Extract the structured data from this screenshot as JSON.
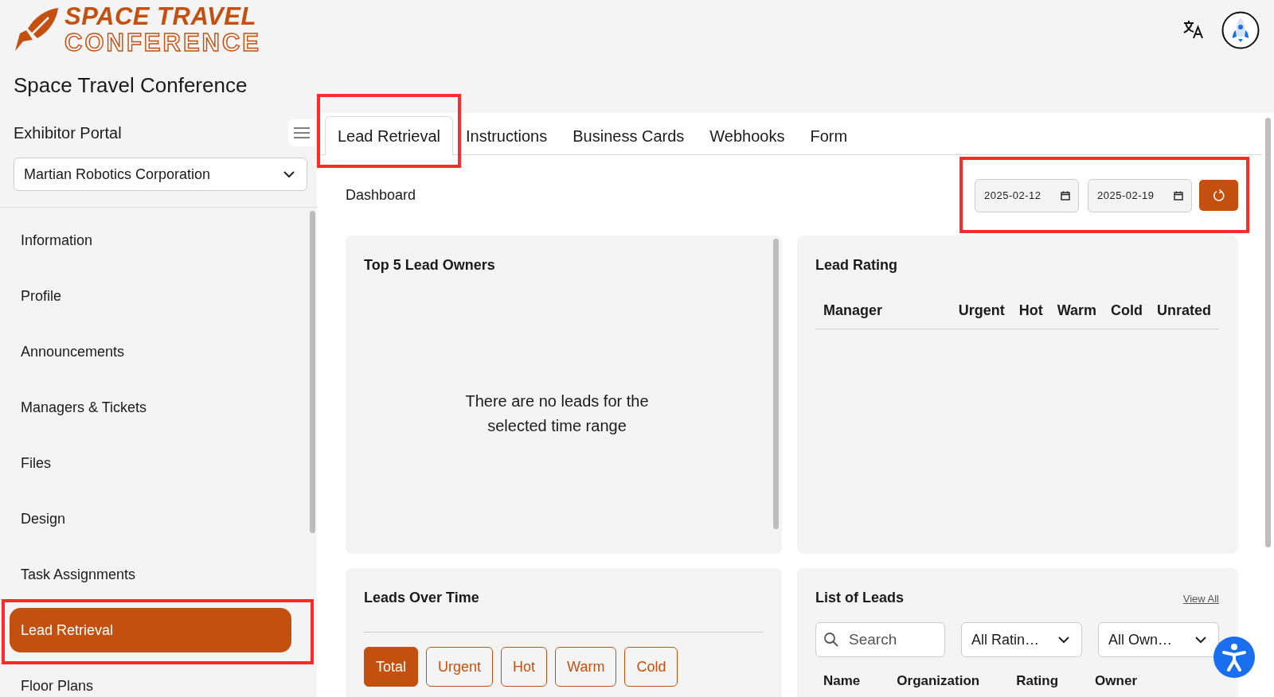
{
  "logo": {
    "line1": "SPACE TRAVEL",
    "line2": "CONFERENCE"
  },
  "event_title": "Space Travel Conference",
  "sidebar": {
    "heading": "Exhibitor Portal",
    "company_select": {
      "value": "Martian Robotics Corporation"
    },
    "items": [
      {
        "label": "Information",
        "selected": false,
        "highlighted": false
      },
      {
        "label": "Profile",
        "selected": false,
        "highlighted": false
      },
      {
        "label": "Announcements",
        "selected": false,
        "highlighted": false
      },
      {
        "label": "Managers & Tickets",
        "selected": false,
        "highlighted": false
      },
      {
        "label": "Files",
        "selected": false,
        "highlighted": false
      },
      {
        "label": "Design",
        "selected": false,
        "highlighted": false
      },
      {
        "label": "Task Assignments",
        "selected": false,
        "highlighted": false
      },
      {
        "label": "Lead Retrieval",
        "selected": true,
        "highlighted": true
      },
      {
        "label": "Floor Plans",
        "selected": false,
        "highlighted": false
      }
    ]
  },
  "tabs": [
    {
      "label": "Lead Retrieval",
      "selected": true,
      "highlighted": true
    },
    {
      "label": "Instructions",
      "selected": false,
      "highlighted": false
    },
    {
      "label": "Business Cards",
      "selected": false,
      "highlighted": false
    },
    {
      "label": "Webhooks",
      "selected": false,
      "highlighted": false
    },
    {
      "label": "Form",
      "selected": false,
      "highlighted": false
    }
  ],
  "dashboard": {
    "title": "Dashboard",
    "date_range": {
      "start": "2025-02-12",
      "end": "2025-02-19",
      "highlighted": true
    }
  },
  "top_lead_owners": {
    "title": "Top 5 Lead Owners",
    "empty_message": "There are no leads for the selected time range"
  },
  "lead_rating": {
    "title": "Lead Rating",
    "columns": [
      "Manager",
      "Urgent",
      "Hot",
      "Warm",
      "Cold",
      "Unrated"
    ]
  },
  "leads_over_time": {
    "title": "Leads Over Time",
    "filters": [
      {
        "label": "Total",
        "selected": true
      },
      {
        "label": "Urgent",
        "selected": false
      },
      {
        "label": "Hot",
        "selected": false
      },
      {
        "label": "Warm",
        "selected": false
      },
      {
        "label": "Cold",
        "selected": false
      }
    ]
  },
  "list_of_leads": {
    "title": "List of Leads",
    "link": "View All",
    "search": {
      "placeholder": "Search"
    },
    "rating_filter": {
      "value": "All Ratin…"
    },
    "owner_filter": {
      "value": "All Own…"
    },
    "columns": [
      "Name",
      "Organization",
      "Rating",
      "Owner"
    ]
  }
}
